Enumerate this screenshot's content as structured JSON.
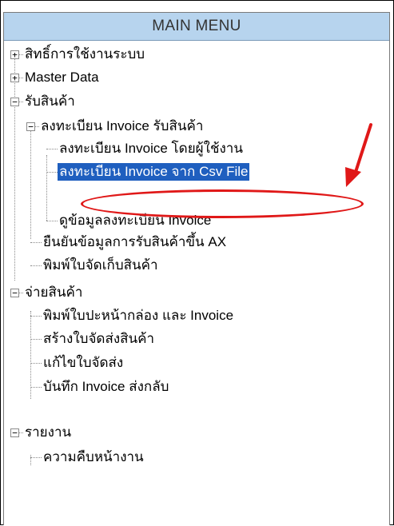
{
  "header": {
    "title": "MAIN MENU"
  },
  "tree": {
    "permissions": "สิทธิ์การใช้งานระบบ",
    "master_data": "Master Data",
    "receive_goods": "รับสินค้า",
    "register_invoice_receive": "ลงทะเบียน Invoice รับสินค้า",
    "register_invoice_by_user": "ลงทะเบียน Invoice โดยผู้ใช้งาน",
    "register_invoice_from_csv": "ลงทะเบียน Invoice จาก Csv File",
    "view_invoice_registration": "ดูข้อมูลลงทะเบียน Invoice",
    "confirm_receive_ax": "ยืนยันข้อมูลการรับสินค้าขึ้น AX",
    "print_storage_slip": "พิมพ์ใบจัดเก็บสินค้า",
    "dispatch_goods": "จ่ายสินค้า",
    "print_box_cover_invoice": "พิมพ์ใบปะหน้ากล่อง และ Invoice",
    "create_delivery_note": "สร้างใบจัดส่งสินค้า",
    "edit_delivery_note": "แก้ไขใบจัดส่ง",
    "record_return_invoice": "บันทึก Invoice ส่งกลับ",
    "reports": "รายงาน",
    "work_progress": "ความคืบหน้างาน"
  },
  "colors": {
    "header_bg": "#b7d4ee",
    "selection_bg": "#1f5fbf",
    "annotation_red": "#e01818"
  }
}
